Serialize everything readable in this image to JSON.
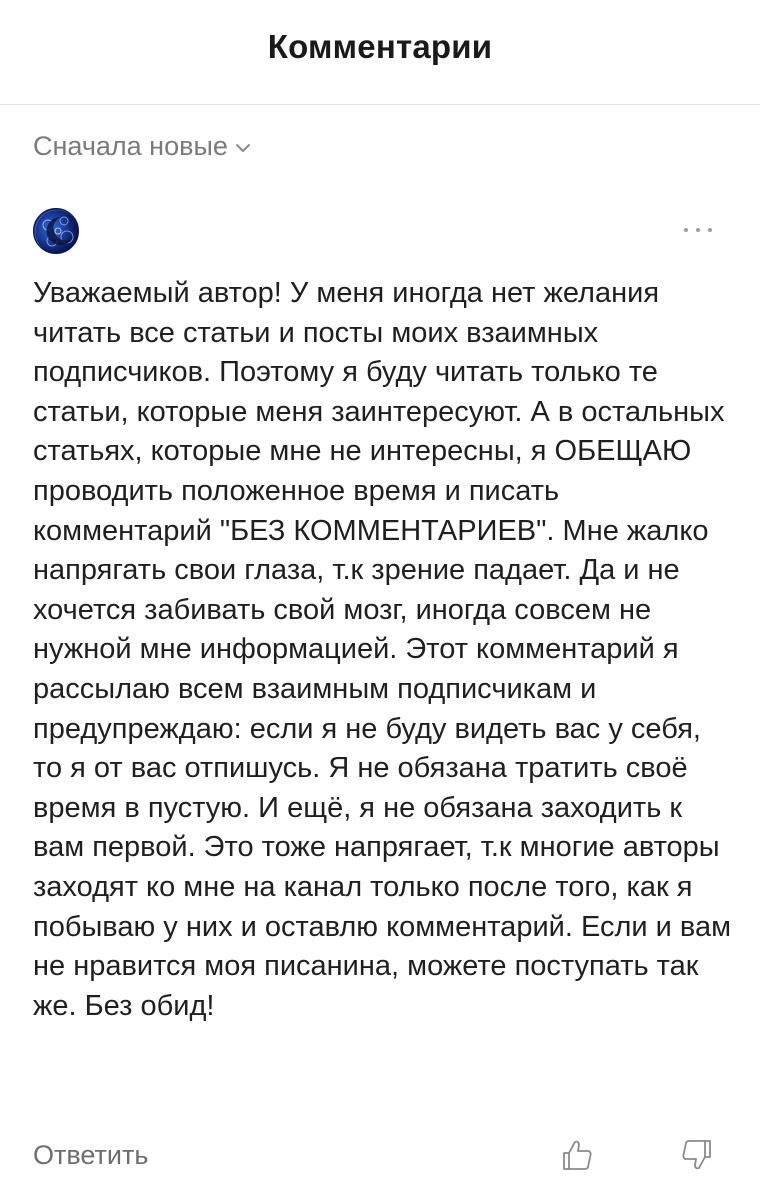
{
  "header": {
    "title": "Комментарии"
  },
  "sort": {
    "label": "Сначала новые",
    "icon": "chevron-down-icon"
  },
  "comment": {
    "avatar_icon": "moon-avatar",
    "more_icon": "more-dots-icon",
    "text": "Уважаемый автор! У меня иногда нет желания читать все статьи и посты моих взаимных подписчиков. Поэтому я буду читать только те статьи, которые меня заинтересуют. А в остальных статьях, которые мне не интересны, я ОБЕЩАЮ проводить положенное время и писать комментарий \"БЕЗ КОММЕНТАРИЕВ\". Мне жалко напрягать свои глаза, т.к зрение падает. Да и не хочется забивать свой мозг, иногда совсем не нужной мне информацией. Этот комментарий я рассылаю всем взаимным подписчикам и предупреждаю: если я не буду видеть вас у себя, то я от вас отпишусь. Я не обязана тратить своё время в пустую. И ещё, я не обязана заходить к вам первой. Это тоже напрягает, т.к многие авторы заходят ко мне на канал только после того, как я побываю у них и оставлю комментарий. Если и вам не нравится моя писанина, можете поступать так же. Без обид!",
    "reply_label": "Ответить",
    "like_icon": "thumbs-up-icon",
    "dislike_icon": "thumbs-down-icon"
  }
}
